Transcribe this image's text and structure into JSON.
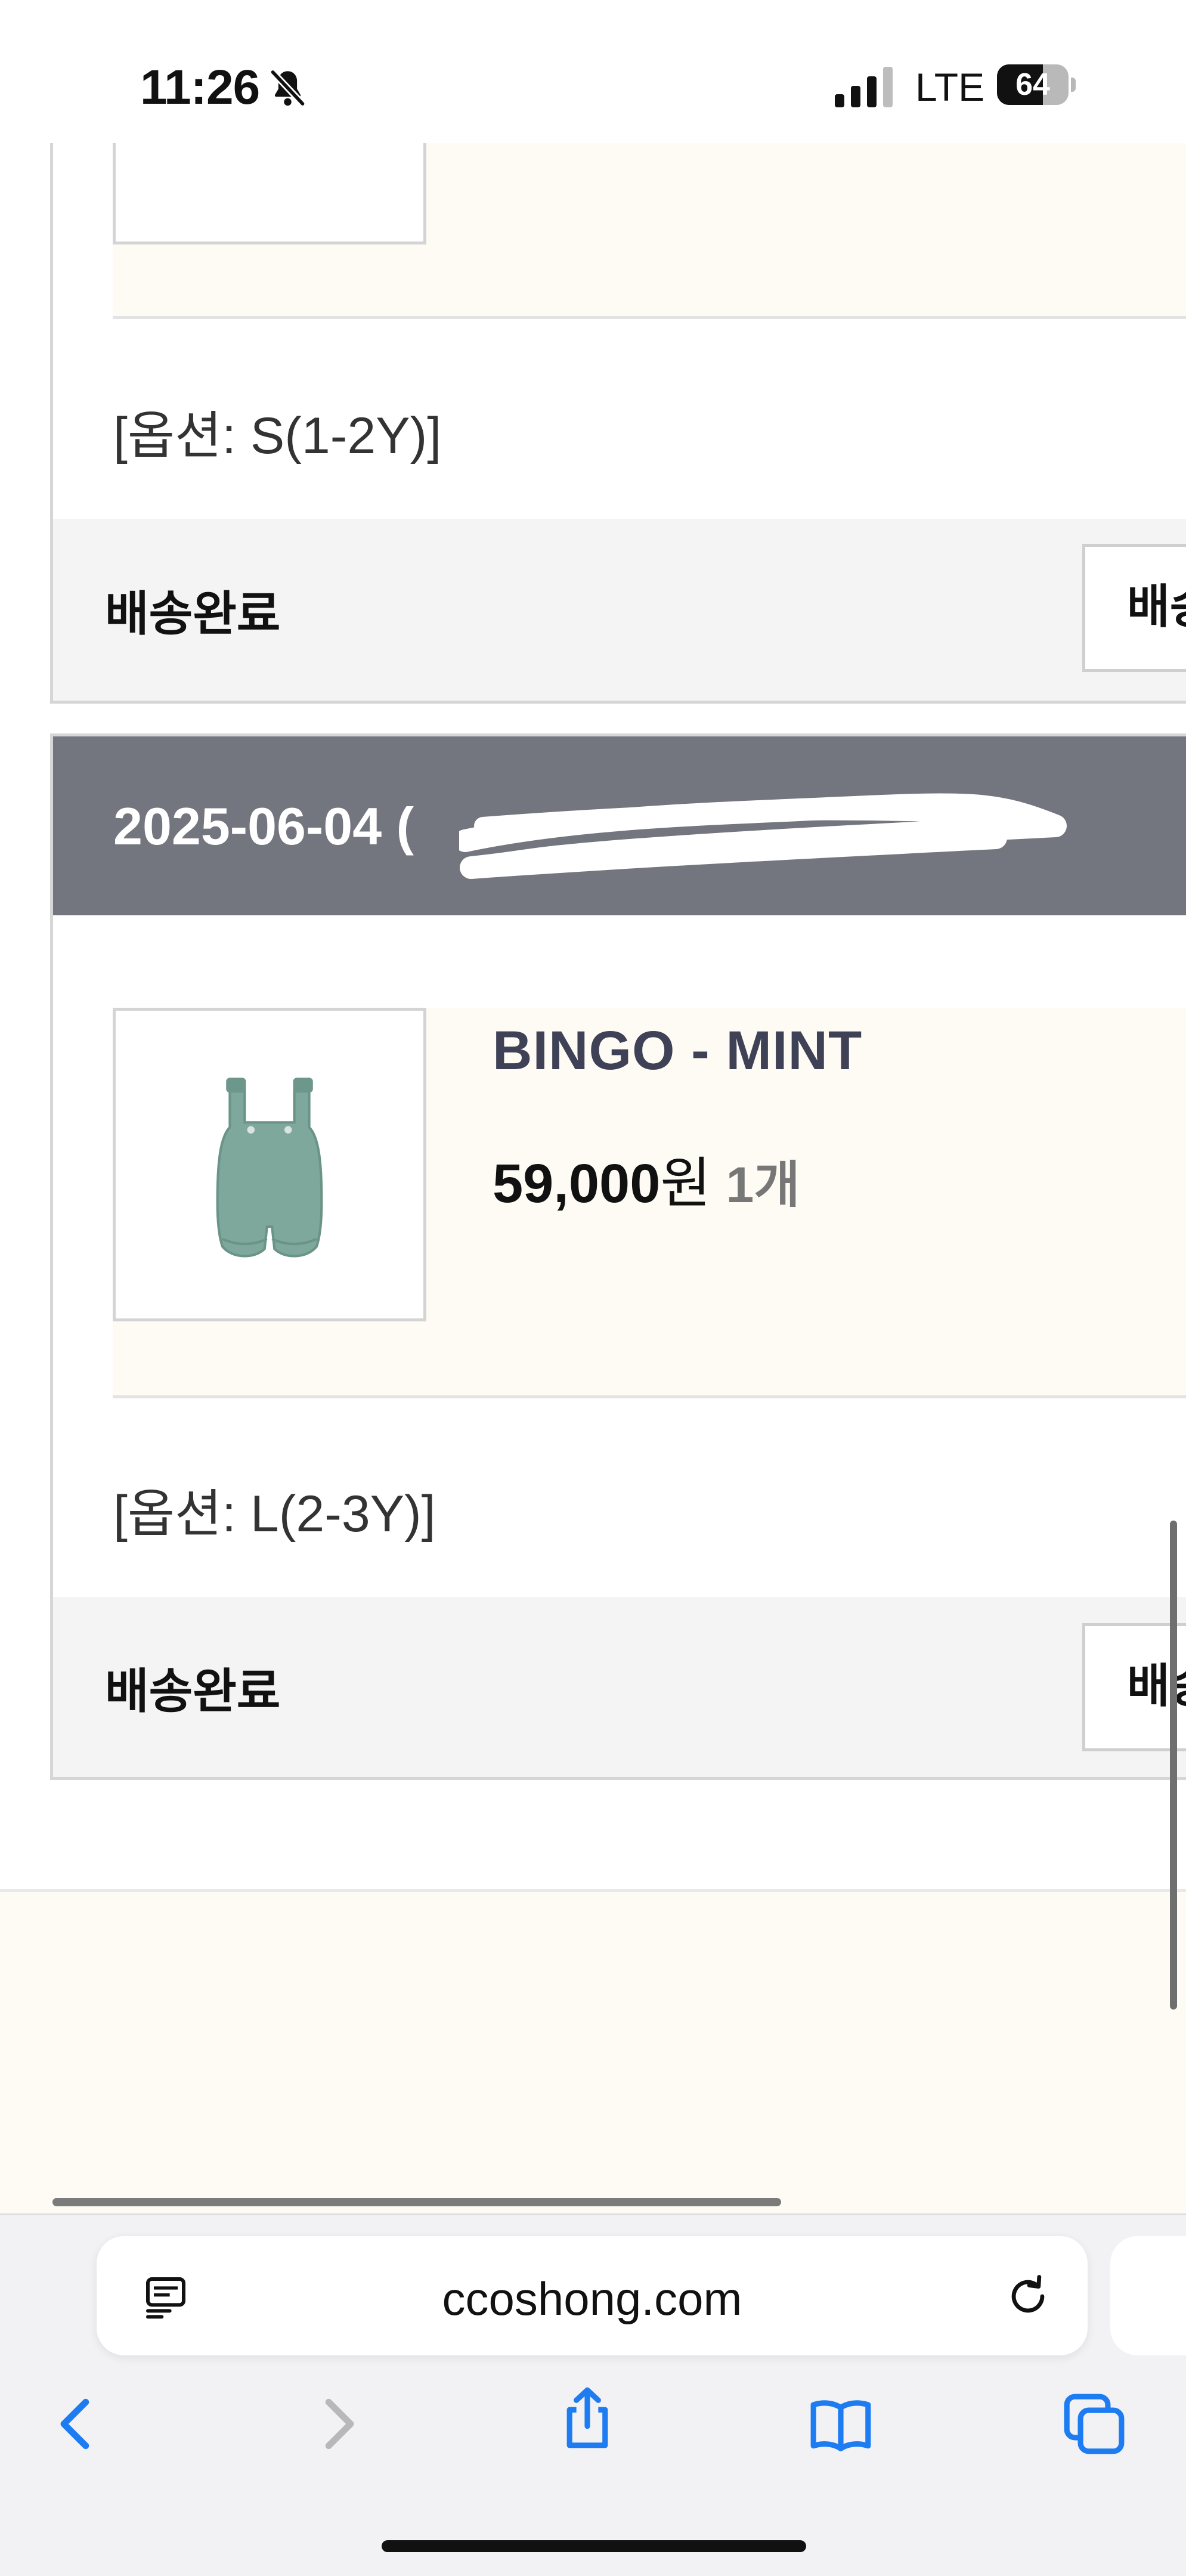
{
  "status_bar": {
    "time": "11:26",
    "network": "LTE",
    "battery_percent": 64,
    "battery_label": "64",
    "silent_mode": true
  },
  "orders": [
    {
      "option": "[옵션: S(1-2Y)]",
      "delivery_status": "배송완료",
      "action_button": "배송"
    },
    {
      "date": "2025-06-04 (",
      "product_name": "BINGO - MINT",
      "price": "59,000",
      "price_unit": "원",
      "quantity": "1",
      "quantity_unit": "개",
      "option": "[옵션: L(2-3Y)]",
      "delivery_status": "배송완료",
      "action_button": "배송"
    }
  ],
  "browser": {
    "url": "ccoshong.com"
  },
  "colors": {
    "header_gray": "#74767f",
    "cream": "#fdfbf3",
    "product_title": "#3f4256",
    "safari_blue": "#1d7cf2"
  },
  "icons": [
    "bell-slash-icon",
    "signal-icon",
    "battery-icon",
    "reader-icon",
    "reload-icon",
    "back-icon",
    "forward-icon",
    "share-icon",
    "bookmarks-icon",
    "tabs-icon"
  ]
}
